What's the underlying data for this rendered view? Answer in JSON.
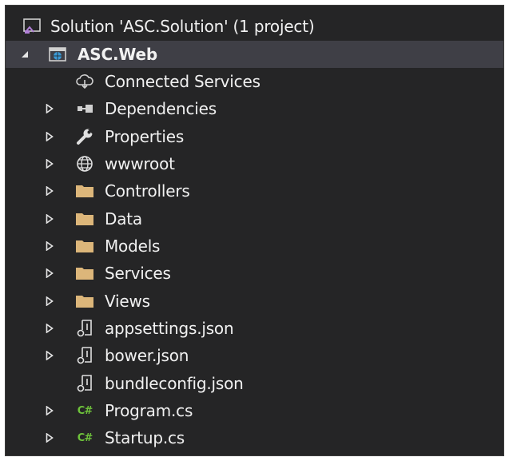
{
  "solution": {
    "label": "Solution 'ASC.Solution' (1 project)",
    "icon": "solution-icon"
  },
  "project": {
    "label": "ASC.Web",
    "icon": "web-project-icon",
    "expanded": true
  },
  "items": [
    {
      "label": "Connected Services",
      "icon": "connected-services-icon",
      "expandable": false
    },
    {
      "label": "Dependencies",
      "icon": "dependencies-icon",
      "expandable": true
    },
    {
      "label": "Properties",
      "icon": "wrench-icon",
      "expandable": true
    },
    {
      "label": "wwwroot",
      "icon": "globe-icon",
      "expandable": true
    },
    {
      "label": "Controllers",
      "icon": "folder-icon",
      "expandable": true
    },
    {
      "label": "Data",
      "icon": "folder-icon",
      "expandable": true
    },
    {
      "label": "Models",
      "icon": "folder-icon",
      "expandable": true
    },
    {
      "label": "Services",
      "icon": "folder-icon",
      "expandable": true
    },
    {
      "label": "Views",
      "icon": "folder-icon",
      "expandable": true
    },
    {
      "label": "appsettings.json",
      "icon": "json-file-icon",
      "expandable": true
    },
    {
      "label": "bower.json",
      "icon": "json-file-icon",
      "expandable": true
    },
    {
      "label": "bundleconfig.json",
      "icon": "json-file-icon",
      "expandable": false
    },
    {
      "label": "Program.cs",
      "icon": "csharp-file-icon",
      "expandable": true
    },
    {
      "label": "Startup.cs",
      "icon": "csharp-file-icon",
      "expandable": true
    }
  ],
  "colors": {
    "background": "#252526",
    "text": "#f1f1f1",
    "folder": "#dcb67a",
    "csharp": "#6ec33b",
    "selected_row": "#3f3f46"
  },
  "csharp_icon_text": "C#"
}
